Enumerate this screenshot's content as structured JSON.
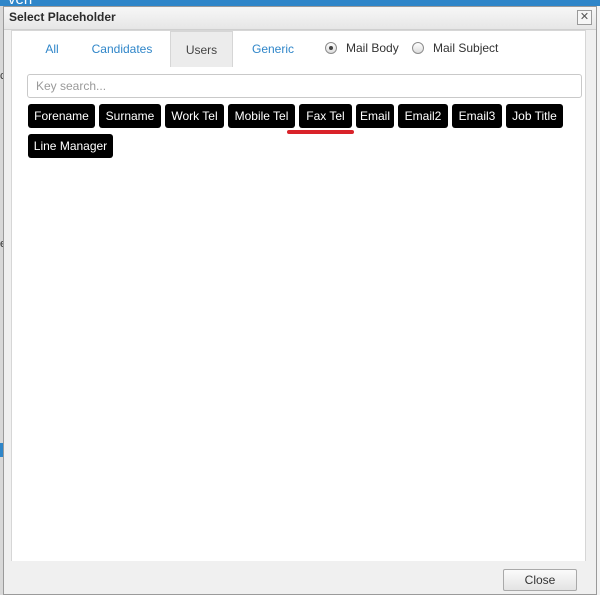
{
  "background": {
    "topbar_text": "ven",
    "left_chars": [
      "c",
      "e"
    ]
  },
  "dialog": {
    "title": "Select Placeholder",
    "close_glyph": "✕"
  },
  "tabs": [
    {
      "label": "All",
      "active": false
    },
    {
      "label": "Candidates",
      "active": false
    },
    {
      "label": "Users",
      "active": true
    },
    {
      "label": "Generic",
      "active": false
    }
  ],
  "radios": [
    {
      "label": "Mail Body",
      "checked": true
    },
    {
      "label": "Mail Subject",
      "checked": false
    }
  ],
  "search": {
    "placeholder": "Key search...",
    "value": ""
  },
  "placeholders": [
    "Forename",
    "Surname",
    "Work Tel",
    "Mobile Tel",
    "Fax Tel",
    "Email",
    "Email2",
    "Email3",
    "Job Title",
    "Line Manager"
  ],
  "footer": {
    "close_label": "Close"
  },
  "colors": {
    "chip_bg": "#000000",
    "chip_text": "#ffffff",
    "link": "#2f86c9",
    "annotation": "#d9232a"
  }
}
